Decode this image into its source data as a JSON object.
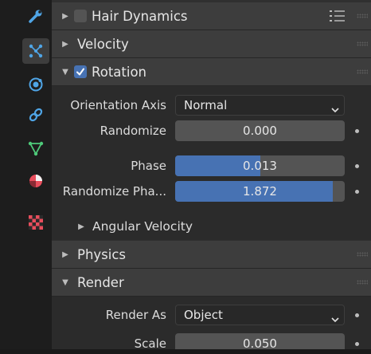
{
  "tabs": [
    {
      "name": "wrench-icon",
      "color": "#4fa5e6"
    },
    {
      "name": "particles-icon",
      "color": "#4fa5e6",
      "active": true
    },
    {
      "name": "physics-icon",
      "color": "#4fa5e6"
    },
    {
      "name": "constraints-icon",
      "color": "#4fa5e6"
    },
    {
      "name": "object-data-icon",
      "color": "#4ec979"
    },
    {
      "name": "material-icon",
      "color": "#e84d5c"
    },
    {
      "name": "texture-icon",
      "color": "#e84d5c"
    }
  ],
  "sections": {
    "hair_dynamics": {
      "title": "Hair Dynamics",
      "checked": false
    },
    "velocity": {
      "title": "Velocity"
    },
    "rotation": {
      "title": "Rotation",
      "checked": true
    },
    "angular_velocity": {
      "title": "Angular Velocity"
    },
    "physics": {
      "title": "Physics"
    },
    "render": {
      "title": "Render"
    }
  },
  "rotation_fields": {
    "orientation_axis": {
      "label": "Orientation Axis",
      "value": "Normal"
    },
    "randomize": {
      "label": "Randomize",
      "value": "0.000",
      "fraction": 0
    },
    "phase": {
      "label": "Phase",
      "value": "0.013",
      "fraction": 0.5
    },
    "randomize_phase": {
      "label": "Randomize Pha...",
      "value": "1.872",
      "fraction": 0.93
    }
  },
  "render_fields": {
    "render_as": {
      "label": "Render As",
      "value": "Object"
    },
    "scale": {
      "label": "Scale",
      "value": "0.050"
    }
  },
  "colors": {
    "accent": "#4772b3",
    "panel": "#303030",
    "header": "#3d3d3d",
    "field": "#545454"
  }
}
